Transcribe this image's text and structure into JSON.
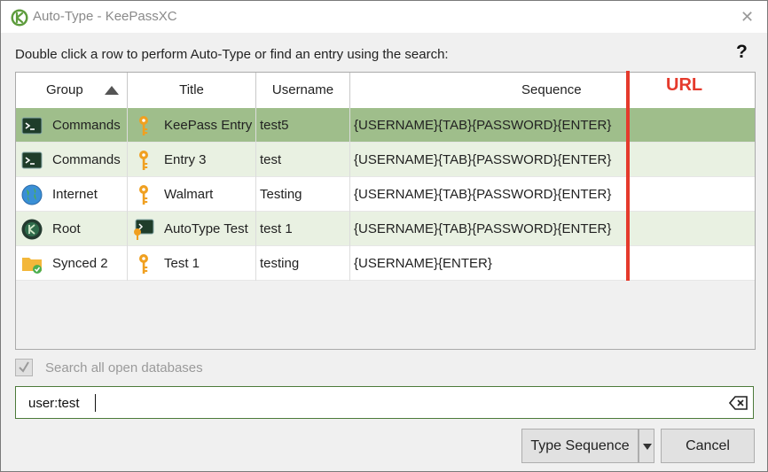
{
  "window": {
    "title": "Auto-Type - KeePassXC"
  },
  "instructions": "Double click a row to perform Auto-Type or find an entry using the search:",
  "help_label": "?",
  "columns": [
    "Group",
    "Title",
    "Username",
    "Sequence"
  ],
  "rows": [
    {
      "group": "Commands",
      "group_icon": "terminal-icon",
      "title": "KeePass Entry",
      "title_icon": "key-icon",
      "username": "test5",
      "sequence": "{USERNAME}{TAB}{PASSWORD}{ENTER}",
      "selected": true
    },
    {
      "group": "Commands",
      "group_icon": "terminal-icon",
      "title": "Entry 3",
      "title_icon": "key-icon",
      "username": "test",
      "sequence": "{USERNAME}{TAB}{PASSWORD}{ENTER}"
    },
    {
      "group": "Internet",
      "group_icon": "globe-icon",
      "title": "Walmart",
      "title_icon": "key-icon",
      "username": "Testing",
      "sequence": "{USERNAME}{TAB}{PASSWORD}{ENTER}"
    },
    {
      "group": "Root",
      "group_icon": "keepassxc-icon",
      "title": "AutoType Test",
      "title_icon": "terminal-key-icon",
      "username": "test 1",
      "sequence": "{USERNAME}{TAB}{PASSWORD}{ENTER}"
    },
    {
      "group": "Synced 2",
      "group_icon": "folder-sync-icon",
      "title": "Test 1",
      "title_icon": "key-icon",
      "username": "testing",
      "sequence": "{USERNAME}{ENTER}"
    }
  ],
  "annotation": {
    "label": "URL",
    "color": "#e53a2c"
  },
  "search_all": {
    "label": "Search all open databases",
    "checked": true,
    "disabled": true
  },
  "search": {
    "value": "user:test"
  },
  "buttons": {
    "type_sequence": "Type Sequence",
    "cancel": "Cancel"
  },
  "colors": {
    "selected_row": "#9fbe8b",
    "alt_row": "#e9f1e2",
    "accent": "#4c7a3a"
  }
}
